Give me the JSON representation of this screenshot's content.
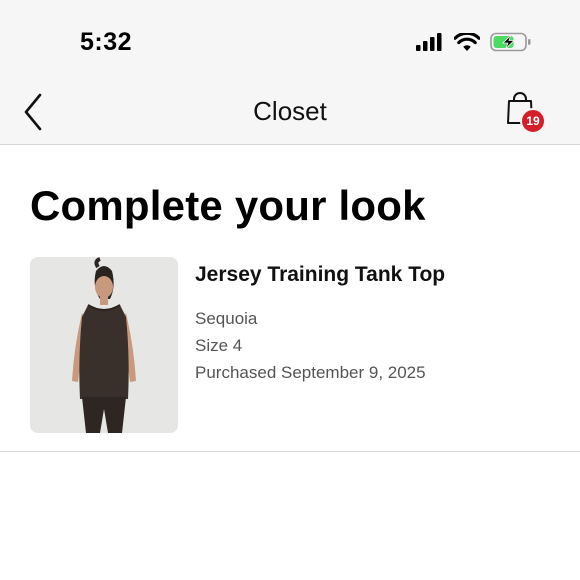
{
  "status_bar": {
    "time": "5:32",
    "icons": [
      "signal-icon",
      "wifi-icon",
      "battery-charging-icon"
    ],
    "battery_color": "#4cd964"
  },
  "nav": {
    "back_icon": "chevron-left-icon",
    "title": "Closet",
    "bag_icon": "shopping-bag-icon",
    "bag_count": "19",
    "badge_color": "#d31f2a"
  },
  "main": {
    "heading": "Complete your look",
    "product": {
      "name": "Jersey Training Tank Top",
      "color": "Sequoia",
      "size": "Size 4",
      "purchased": "Purchased September 9, 2025"
    }
  }
}
